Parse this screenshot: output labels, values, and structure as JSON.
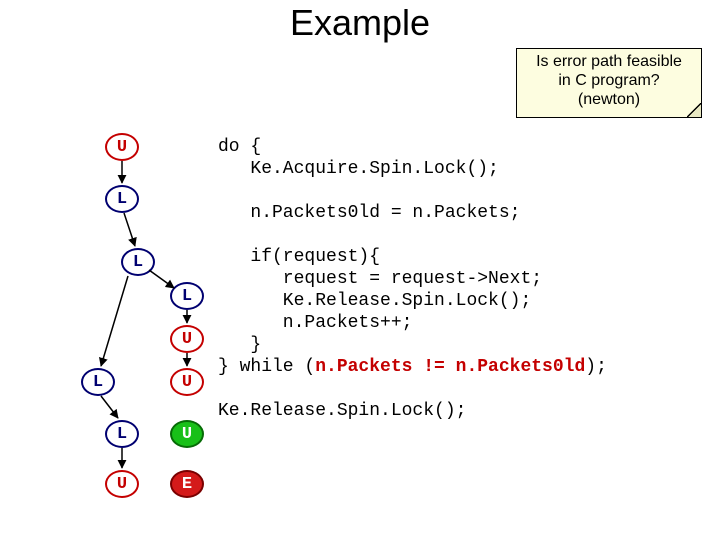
{
  "title": "Example",
  "note": {
    "line1": "Is error path feasible",
    "line2": "in C program?",
    "line3": "(newton)"
  },
  "code": {
    "l1": "do {",
    "l2": "   Ke.Acquire.Spin.Lock();",
    "l4": "   n.Packets0ld = n.Packets;",
    "l6": "   if(request){",
    "l7": "      request = request->Next;",
    "l8": "      Ke.Release.Spin.Lock();",
    "l9": "      n.Packets++;",
    "l10": "   }",
    "l11a": "} while (",
    "l11b": "n.Packets != n.Packets0ld",
    "l11c": ");",
    "l13": "Ke.Release.Spin.Lock();"
  },
  "nodes": {
    "u1": "U",
    "l1": "L",
    "l2": "L",
    "linner1": "L",
    "uinner": "U",
    "lbot": "L",
    "uw": "U",
    "l3": "L",
    "u3": "U",
    "ufinal": "U",
    "e": "E"
  }
}
